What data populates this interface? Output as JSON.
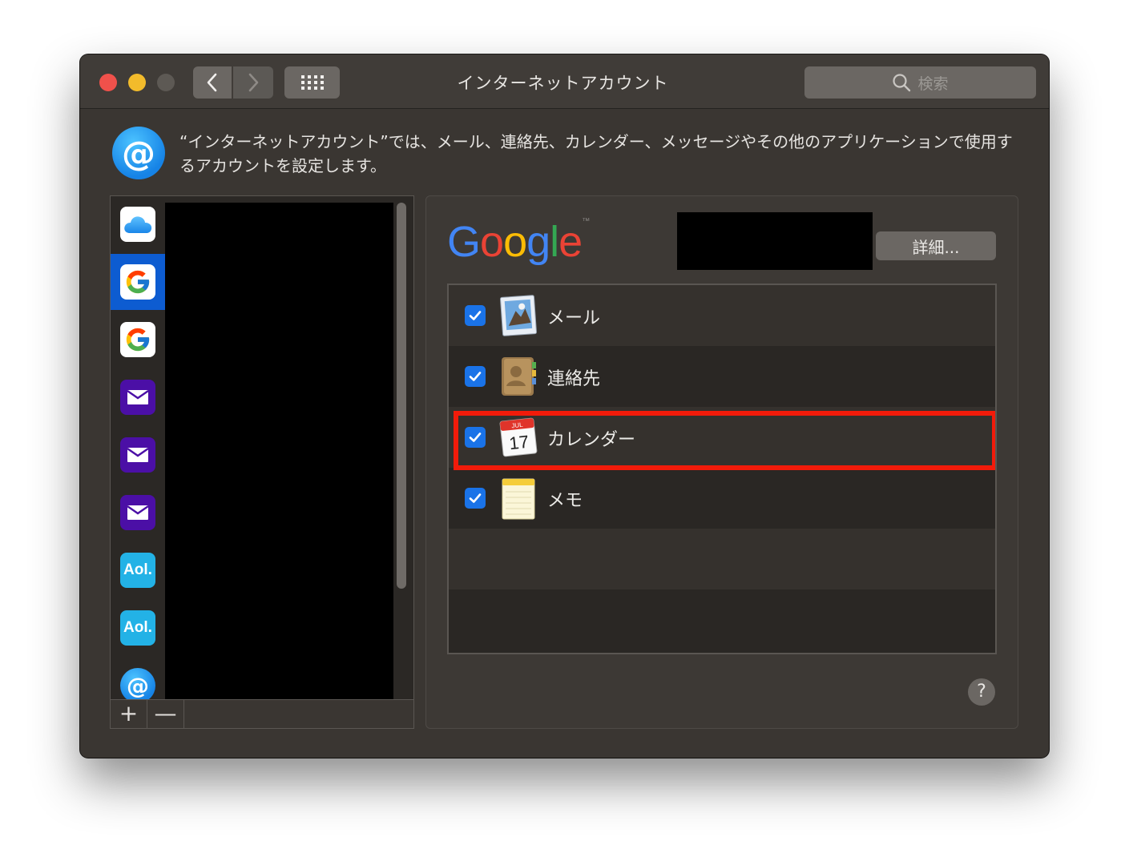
{
  "window": {
    "title": "インターネットアカウント",
    "search_placeholder": "検索"
  },
  "header": {
    "description": "“インターネットアカウント”では、メール、連絡先、カレンダー、メッセージやその他のアプリケーションで使用するアカウントを設定します。"
  },
  "accounts": [
    {
      "type": "icloud",
      "icon": "icloud-icon"
    },
    {
      "type": "google",
      "icon": "google-icon",
      "selected": true
    },
    {
      "type": "google",
      "icon": "google-icon"
    },
    {
      "type": "yahoo",
      "icon": "yahoo-mail-icon"
    },
    {
      "type": "yahoo",
      "icon": "yahoo-mail-icon"
    },
    {
      "type": "yahoo",
      "icon": "yahoo-mail-icon"
    },
    {
      "type": "aol",
      "icon": "aol-icon",
      "text": "Aol."
    },
    {
      "type": "aol",
      "icon": "aol-icon",
      "text": "Aol."
    },
    {
      "type": "other",
      "icon": "at-icon",
      "text": "@"
    }
  ],
  "list_buttons": {
    "add": "+",
    "remove": "—"
  },
  "detail": {
    "provider": "Google",
    "details_button": "詳細...",
    "services": [
      {
        "label": "メール",
        "checked": true,
        "icon": "mail-app-icon"
      },
      {
        "label": "連絡先",
        "checked": true,
        "icon": "contacts-app-icon"
      },
      {
        "label": "カレンダー",
        "checked": true,
        "icon": "calendar-app-icon",
        "highlighted": true
      },
      {
        "label": "メモ",
        "checked": true,
        "icon": "notes-app-icon"
      }
    ],
    "calendar_month": "JUL",
    "calendar_day": "17",
    "help": "?"
  },
  "colors": {
    "accent": "#1a73e8",
    "highlight": "#f21b0a",
    "selection": "#0d5cd1"
  }
}
